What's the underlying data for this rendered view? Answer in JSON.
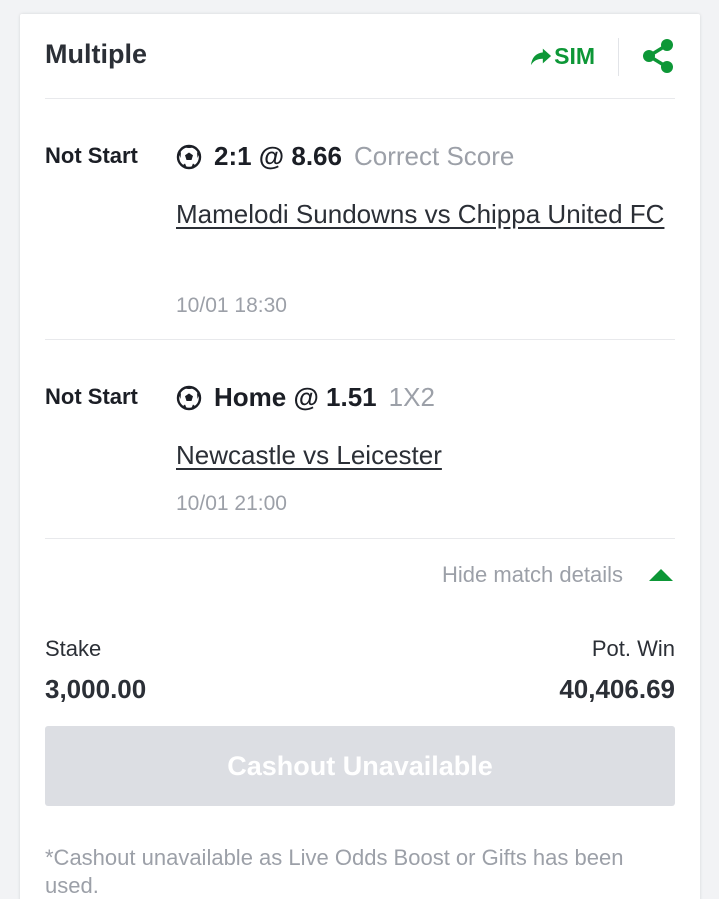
{
  "header": {
    "title": "Multiple",
    "sim_label": "SIM"
  },
  "selections": [
    {
      "status": "Not Start",
      "pick": "2:1 @ 8.66",
      "market": "Correct Score",
      "match": "Mamelodi Sundowns vs Chippa United FC",
      "time": "10/01 18:30"
    },
    {
      "status": "Not Start",
      "pick": "Home @ 1.51",
      "market": "1X2",
      "match": "Newcastle vs Leicester",
      "time": "10/01 21:00"
    }
  ],
  "details_toggle": {
    "label": "Hide match details"
  },
  "summary": {
    "stake_label": "Stake",
    "stake_value": "3,000.00",
    "pot_win_label": "Pot. Win",
    "pot_win_value": "40,406.69"
  },
  "cashout": {
    "label": "Cashout Unavailable",
    "note": "*Cashout unavailable as Live Odds Boost or Gifts has been used."
  },
  "colors": {
    "accent_green": "#0d9737",
    "muted_text": "#9ca0a8",
    "disabled_button": "#dcdee3"
  },
  "icons": {
    "sim": "forward-arrow-icon",
    "share": "share-icon",
    "sport": "soccer-ball-icon",
    "toggle": "triangle-up-icon"
  }
}
